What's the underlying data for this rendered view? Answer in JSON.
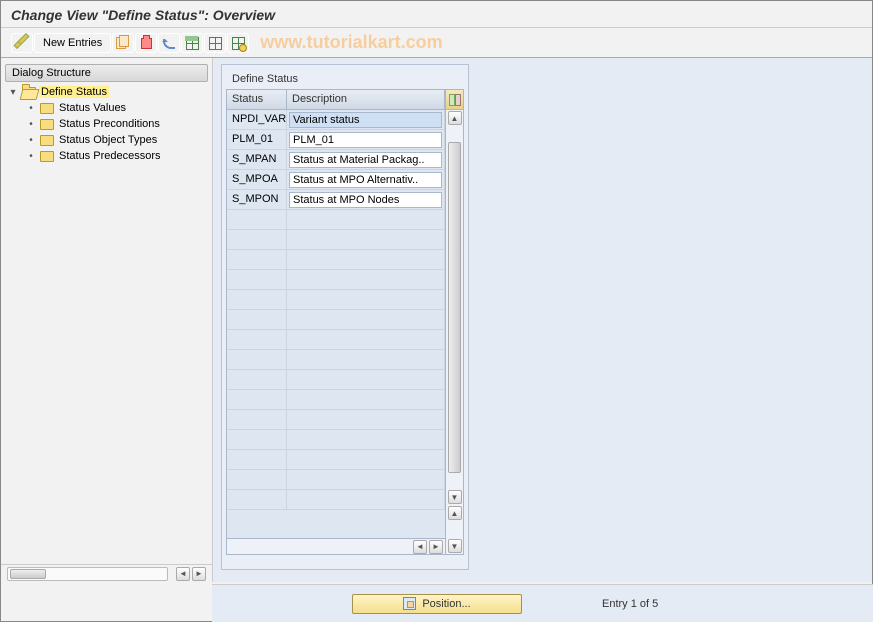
{
  "title": "Change View \"Define Status\": Overview",
  "watermark": "www.tutorialkart.com",
  "toolbar": {
    "new_entries": "New Entries"
  },
  "tree": {
    "header": "Dialog Structure",
    "root": "Define Status",
    "children": [
      "Status Values",
      "Status Preconditions",
      "Status Object Types",
      "Status Predecessors"
    ]
  },
  "table": {
    "title": "Define Status",
    "columns": {
      "c1": "Status",
      "c2": "Description"
    },
    "rows": [
      {
        "status": "NPDI_VAR",
        "desc": "Variant status",
        "selected": true
      },
      {
        "status": "PLM_01",
        "desc": "PLM_01"
      },
      {
        "status": "S_MPAN",
        "desc": "Status at Material Packag.."
      },
      {
        "status": "S_MPOA",
        "desc": "Status at MPO Alternativ.."
      },
      {
        "status": "S_MPON",
        "desc": "Status at MPO Nodes"
      }
    ],
    "empty_rows": 15
  },
  "footer": {
    "position_btn": "Position...",
    "entry_text": "Entry 1 of 5"
  }
}
